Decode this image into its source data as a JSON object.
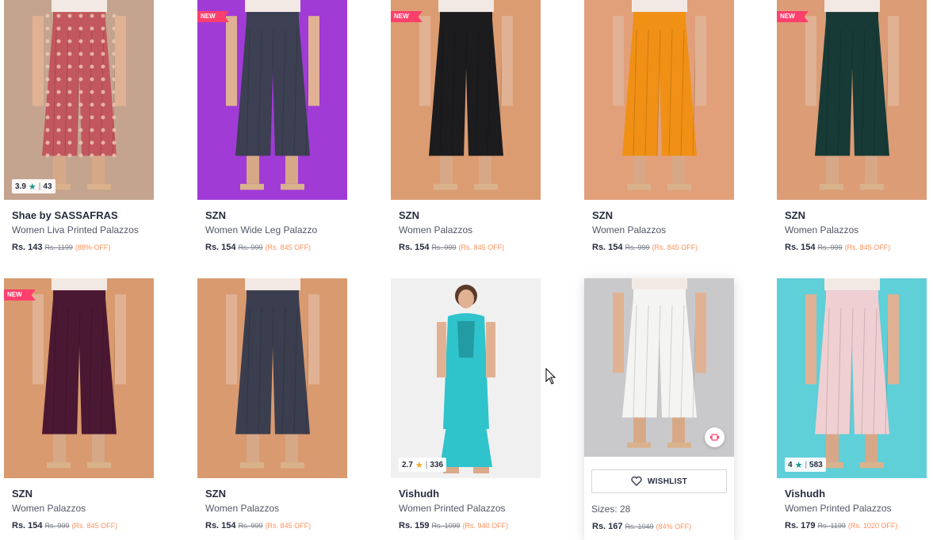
{
  "products": [
    {
      "brand": "Shae by SASSAFRAS",
      "name": "Women Liva Printed Palazzos",
      "price": "Rs. 143",
      "mrp": "Rs. 1199",
      "discount": "(88% OFF)",
      "rating": "3.9",
      "rating_count": "43",
      "bg": "#c4a48f",
      "pant": "#c2575f",
      "pattern": true
    },
    {
      "brand": "SZN",
      "name": "Women Wide Leg Palazzo",
      "price": "Rs. 154",
      "mrp": "Rs. 999",
      "discount": "(Rs. 845 OFF)",
      "badge": "NEW",
      "bg": "#a03bd6",
      "pant": "#3c4052"
    },
    {
      "brand": "SZN",
      "name": "Women Palazzos",
      "price": "Rs. 154",
      "mrp": "Rs. 999",
      "discount": "(Rs. 845 OFF)",
      "badge": "NEW",
      "bg": "#dc9c72",
      "pant": "#1c1c1e"
    },
    {
      "brand": "SZN",
      "name": "Women Palazzos",
      "price": "Rs. 154",
      "mrp": "Rs. 999",
      "discount": "(Rs. 845 OFF)",
      "bg": "#e2a07a",
      "pant": "#f09015"
    },
    {
      "brand": "SZN",
      "name": "Women Palazzos",
      "price": "Rs. 154",
      "mrp": "Rs. 999",
      "discount": "(Rs. 845 OFF)",
      "badge": "NEW",
      "bg": "#db9c76",
      "pant": "#173a36"
    },
    {
      "brand": "SZN",
      "name": "Women Palazzos",
      "price": "Rs. 154",
      "mrp": "Rs. 999",
      "discount": "(Rs. 845 OFF)",
      "badge": "NEW",
      "bg": "#d89a6e",
      "pant": "#4a1832"
    },
    {
      "brand": "SZN",
      "name": "Women Palazzos",
      "price": "Rs. 154",
      "mrp": "Rs. 999",
      "discount": "(Rs. 845 OFF)",
      "bg": "#d99a70",
      "pant": "#3b3e4f"
    },
    {
      "brand": "Vishudh",
      "name": "Women Printed Palazzos",
      "price": "Rs. 159",
      "mrp": "Rs. 1099",
      "discount": "(Rs. 940 OFF)",
      "rating": "2.7",
      "rating_count": "336",
      "star": "gold",
      "bg": "#f0f0f0",
      "pant": "#2fc3cc",
      "kurta": true
    },
    {
      "brand": "",
      "name": "",
      "price": "Rs. 167",
      "mrp": "Rs. 1049",
      "discount": "(84% OFF)",
      "hover": true,
      "wishlist_label": "WISHLIST",
      "sizes": "Sizes: 28",
      "bg": "#c9c9cc",
      "pant": "#f4f4f2"
    },
    {
      "brand": "Vishudh",
      "name": "Women Printed Palazzos",
      "price": "Rs. 179",
      "mrp": "Rs. 1199",
      "discount": "(Rs. 1020 OFF)",
      "rating": "4",
      "rating_count": "583",
      "bg": "#5fcfd8",
      "pant": "#efcfd2"
    }
  ]
}
